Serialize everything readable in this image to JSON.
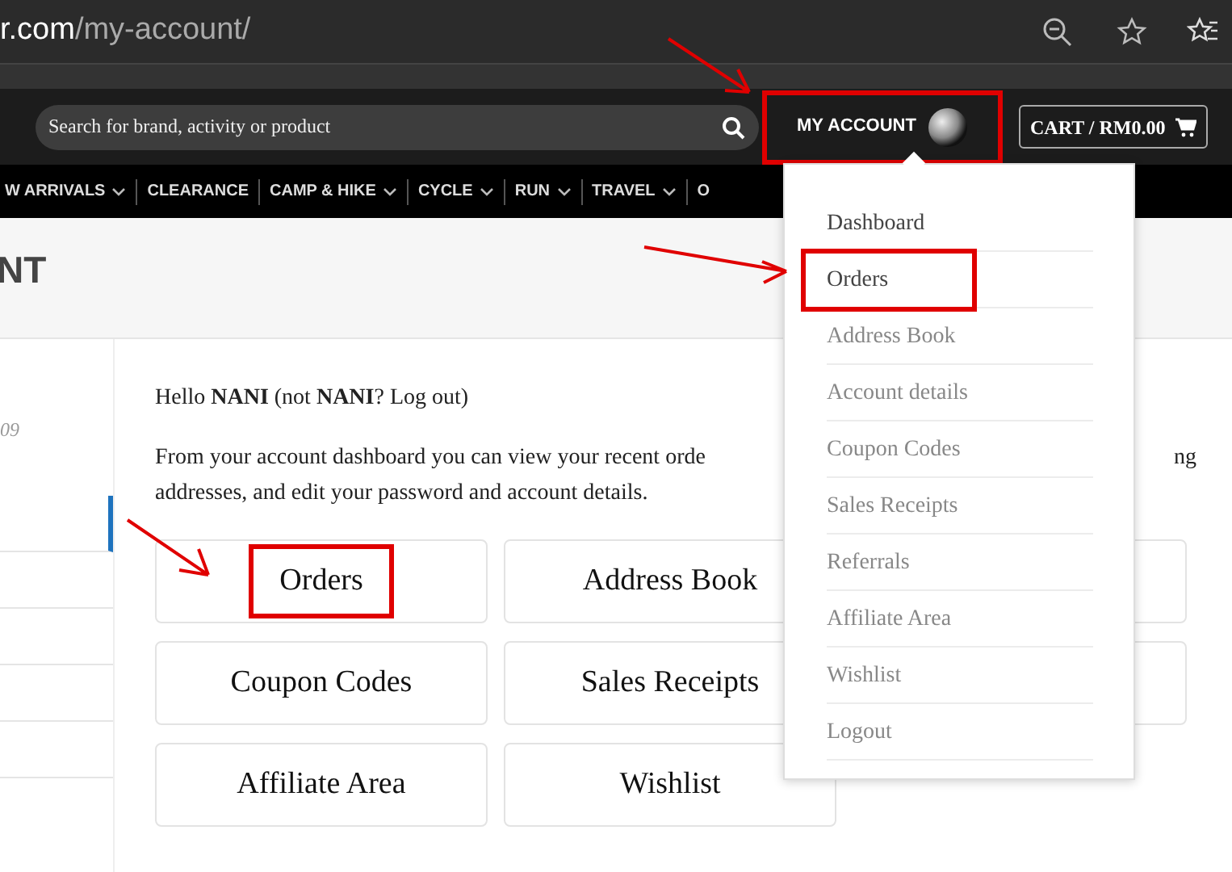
{
  "browser": {
    "url_host": "r.com",
    "url_path": "/my-account/"
  },
  "header": {
    "search": {
      "placeholder": "Search for brand, activity or product"
    },
    "account": {
      "label": "MY ACCOUNT",
      "highlighted": true
    },
    "cart": {
      "label": "CART / RM0.00"
    }
  },
  "nav": [
    {
      "label": "W ARRIVALS",
      "has_submenu": true
    },
    {
      "label": "CLEARANCE",
      "has_submenu": false
    },
    {
      "label": "CAMP & HIKE",
      "has_submenu": true
    },
    {
      "label": "CYCLE",
      "has_submenu": true
    },
    {
      "label": "RUN",
      "has_submenu": true
    },
    {
      "label": "TRAVEL",
      "has_submenu": true
    },
    {
      "label": "O",
      "has_submenu": false
    }
  ],
  "page_title": "NT",
  "sidebar": {
    "text": "09",
    "items": [
      {
        "selected": true
      },
      {
        "selected": false
      },
      {
        "selected": false
      },
      {
        "selected": false
      },
      {
        "selected": false
      }
    ]
  },
  "greeting": "Hello **NANI** (not **NANI**? Log out)",
  "intro": {
    "line_1_start": "From your account dashboard you can view your recent orde",
    "line_1_end": "ng",
    "line_2": "addresses, and edit your password and account details."
  },
  "tiles": [
    {
      "kind": "label",
      "label": "Orders",
      "highlighted": true
    },
    {
      "kind": "label",
      "label": "Address Book",
      "highlighted": false
    },
    {
      "kind": "covered"
    },
    {
      "kind": "label",
      "label": "Coupon Codes",
      "highlighted": false
    },
    {
      "kind": "label",
      "label": "Sales Receipts",
      "highlighted": false
    },
    {
      "kind": "covered"
    },
    {
      "kind": "label",
      "label": "Affiliate Area",
      "highlighted": false
    },
    {
      "kind": "label",
      "label": "Wishlist",
      "highlighted": false
    }
  ],
  "account_menu": [
    {
      "label": "Dashboard",
      "emphasized": true,
      "highlighted": false
    },
    {
      "label": "Orders",
      "emphasized": true,
      "highlighted": true
    },
    {
      "label": "Address Book",
      "emphasized": false,
      "highlighted": false
    },
    {
      "label": "Account details",
      "emphasized": false,
      "highlighted": false
    },
    {
      "label": "Coupon Codes",
      "emphasized": false,
      "highlighted": false
    },
    {
      "label": "Sales Receipts",
      "emphasized": false,
      "highlighted": false
    },
    {
      "label": "Referrals",
      "emphasized": false,
      "highlighted": false
    },
    {
      "label": "Affiliate Area",
      "emphasized": false,
      "highlighted": false
    },
    {
      "label": "Wishlist",
      "emphasized": false,
      "highlighted": false
    },
    {
      "label": "Logout",
      "emphasized": false,
      "highlighted": false
    }
  ]
}
